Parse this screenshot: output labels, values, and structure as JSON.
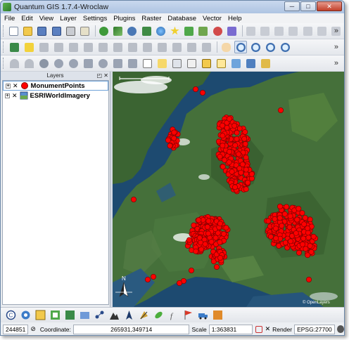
{
  "window": {
    "title": "Quantum GIS 1.7.4-Wroclaw",
    "minimize_label": "─",
    "maximize_label": "□",
    "close_label": "✕"
  },
  "menu": [
    "File",
    "Edit",
    "View",
    "Layer",
    "Settings",
    "Plugins",
    "Raster",
    "Database",
    "Vector",
    "Help"
  ],
  "toolbars": {
    "file": [
      "new-project",
      "open-project",
      "save-project",
      "save-as",
      "print-composer",
      "composer-manager"
    ],
    "layers": [
      "add-vector",
      "add-raster",
      "add-postgis",
      "add-spatialite",
      "add-wms",
      "add-wfs",
      "add-mssql",
      "new-shapefile",
      "remove-layer"
    ],
    "digitize": [
      "toggle-editing",
      "save-edits",
      "add-feature",
      "move-feature",
      "node-tool",
      "delete-selected",
      "cut",
      "copy",
      "paste"
    ],
    "overflow_label": "»"
  },
  "layers_panel": {
    "title": "Layers",
    "float_label": "◰",
    "close_label": "✕",
    "layers": [
      {
        "name": "MonumentPoints",
        "visible": true,
        "expander": "+",
        "check": "✕",
        "selected": true
      },
      {
        "name": "ESRIWorldImagery",
        "visible": true,
        "expander": "+",
        "check": "✕",
        "selected": false
      }
    ]
  },
  "map": {
    "point_color": "#ff0000",
    "point_outline": "#8a0000",
    "north_arrow": "N",
    "copyright": "© OpenLayers"
  },
  "status": {
    "left_value": "244851",
    "coordinate_label": "Coordinate:",
    "coordinate_value": "265931,349714",
    "scale_label": "Scale",
    "scale_value": "1:363831",
    "render_label": "Render",
    "render_checked": "✕",
    "epsg": "EPSG:27700"
  },
  "colors": {
    "titlebar": "#b7cbe7",
    "toolbar": "#eceef2",
    "map_water": "#1d4a70",
    "land": "#3f6b34",
    "accent": "#6fa2d8"
  }
}
